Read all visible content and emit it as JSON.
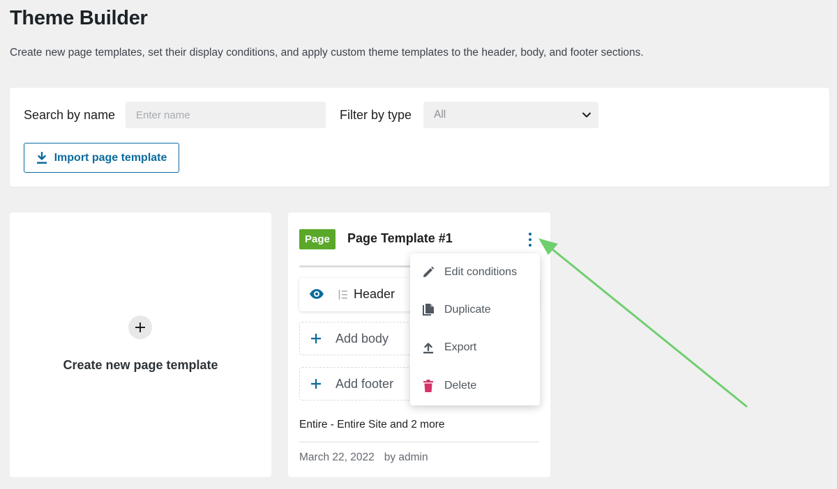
{
  "page": {
    "title": "Theme Builder",
    "description": "Create new page templates, set their display conditions, and apply custom theme templates to the header, body, and footer sections."
  },
  "filters": {
    "search_label": "Search by name",
    "search_placeholder": "Enter name",
    "filter_label": "Filter by type",
    "filter_value": "All",
    "import_label": "Import page template"
  },
  "create_card": {
    "label": "Create new page template"
  },
  "template_card": {
    "badge": "Page",
    "title": "Page Template #1",
    "header_label": "Header",
    "add_body": "Add body",
    "add_footer": "Add footer",
    "conditions": "Entire - Entire Site and 2 more",
    "date": "March 22, 2022",
    "author": "by admin"
  },
  "menu": {
    "edit": "Edit conditions",
    "duplicate": "Duplicate",
    "export": "Export",
    "delete": "Delete"
  },
  "colors": {
    "accent": "#0a6b9e",
    "badge": "#5aa82a",
    "delete": "#d6336c",
    "arrow": "#6fcf6f"
  }
}
